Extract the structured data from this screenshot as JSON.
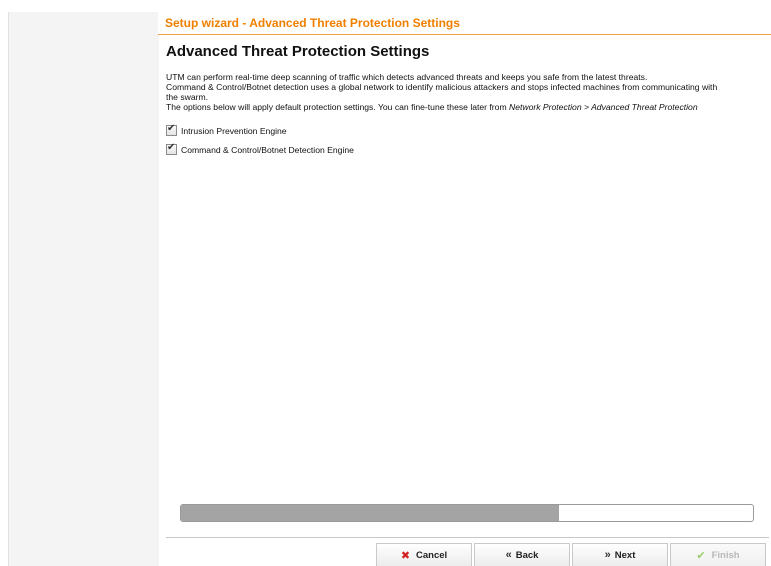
{
  "header": {
    "wizard_title": "Setup wizard - Advanced Threat Protection Settings"
  },
  "main": {
    "page_title": "Advanced Threat Protection Settings",
    "description": {
      "line1": "UTM can perform real-time deep scanning of traffic which detects advanced threats and keeps you safe from the latest threats.",
      "line2": "Command & Control/Botnet detection uses a global network to identify malicious attackers and stops infected machines from communicating with",
      "line3": "the swarm.",
      "line4_prefix": "The options below will apply default protection settings. You can fine-tune these later from ",
      "line4_path": "Network Protection > Advanced Threat Protection"
    },
    "options": [
      {
        "label": "Intrusion Prevention Engine",
        "checked": true
      },
      {
        "label": "Command & Control/Botnet Detection Engine",
        "checked": true
      }
    ]
  },
  "progress": {
    "percent": 66
  },
  "footer": {
    "cancel_label": "Cancel",
    "back_label": "Back",
    "next_label": "Next",
    "finish_label": "Finish",
    "cancel_icon": "x-icon",
    "back_icon": "double-chevron-left-icon",
    "next_icon": "double-chevron-right-icon",
    "finish_icon": "check-icon"
  },
  "colors": {
    "accent": "#f07f00",
    "progress_fill": "#a4a4a4",
    "cancel_icon": "#d42020",
    "finish_icon": "#9ccf6a"
  }
}
